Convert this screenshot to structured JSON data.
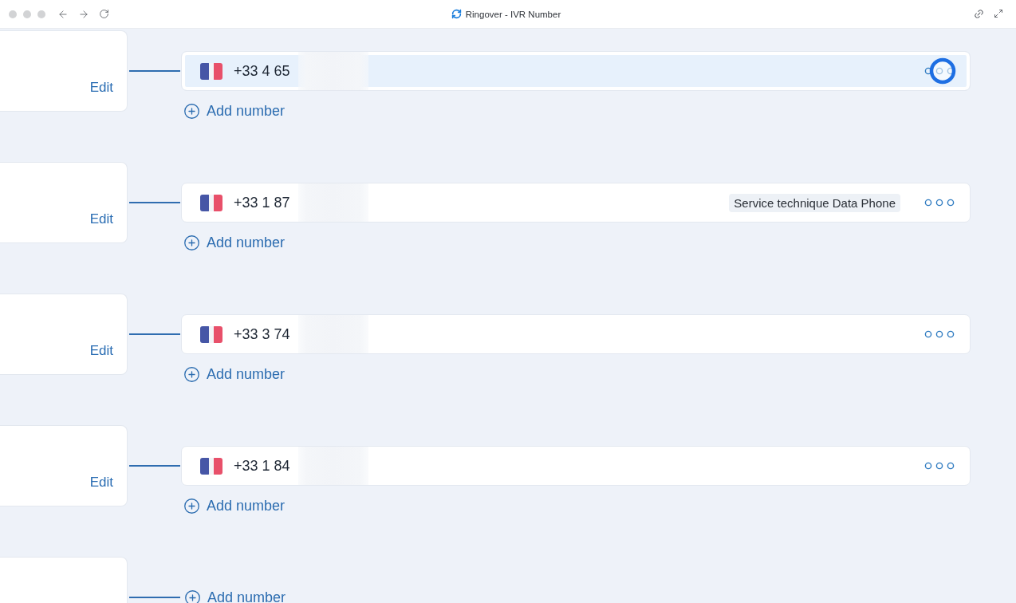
{
  "window": {
    "title": "Ringover - IVR Number"
  },
  "groups": [
    {
      "edit_label": "Edit",
      "numbers": [
        {
          "number": "+33 4 65",
          "selected": true,
          "menu_pressed": true
        }
      ],
      "add_label": "Add number"
    },
    {
      "edit_label": "Edit",
      "numbers": [
        {
          "number": "+33 1 87",
          "selected": false,
          "menu_pressed": false,
          "tag": "Service technique Data Phone"
        }
      ],
      "add_label": "Add number"
    },
    {
      "edit_label": "Edit",
      "numbers": [
        {
          "number": "+33 3 74",
          "selected": false,
          "menu_pressed": false
        }
      ],
      "add_label": "Add number"
    },
    {
      "edit_label": "Edit",
      "numbers": [
        {
          "number": "+33 1 84",
          "selected": false,
          "menu_pressed": false
        }
      ],
      "add_label": "Add number"
    },
    {
      "add_label": "Add number"
    }
  ]
}
